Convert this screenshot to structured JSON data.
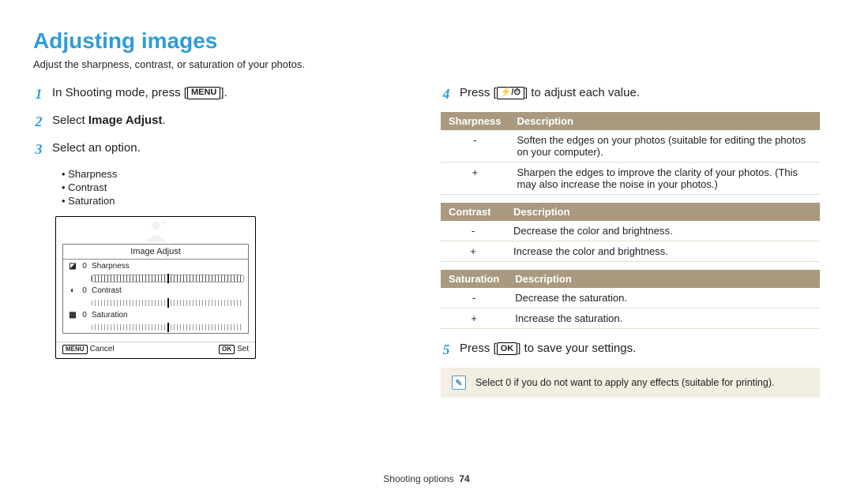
{
  "title": "Adjusting images",
  "intro": "Adjust the sharpness, contrast, or saturation of your photos.",
  "steps": {
    "s1_pre": "In Shooting mode, press [",
    "s1_key": "MENU",
    "s1_post": "].",
    "s2_pre": "Select ",
    "s2_bold": "Image Adjust",
    "s2_post": ".",
    "s3": "Select an option.",
    "s4_pre": "Press [",
    "s4_key": "⚡/⏱",
    "s4_post": "] to adjust each value.",
    "s5_pre": "Press [",
    "s5_key": "OK",
    "s5_post": "] to save your settings."
  },
  "bullets": [
    "Sharpness",
    "Contrast",
    "Saturation"
  ],
  "screenshot": {
    "title": "Image Adjust",
    "rows": [
      {
        "icon": "◪",
        "val": "0",
        "label": "Sharpness",
        "sel": true
      },
      {
        "icon": "◐",
        "val": "0",
        "label": "Contrast",
        "sel": false
      },
      {
        "icon": "▦",
        "val": "0",
        "label": "Saturation",
        "sel": false
      }
    ],
    "cancel_key": "MENU",
    "cancel": "Cancel",
    "set_key": "OK",
    "set": "Set"
  },
  "tables": [
    {
      "h1": "Sharpness",
      "h2": "Description",
      "rows": [
        {
          "k": "-",
          "v": "Soften the edges on your photos (suitable for editing the photos on your computer)."
        },
        {
          "k": "+",
          "v": "Sharpen the edges to improve the clarity of your photos. (This may also increase the noise in your photos.)"
        }
      ]
    },
    {
      "h1": "Contrast",
      "h2": "Description",
      "rows": [
        {
          "k": "-",
          "v": "Decrease the color and brightness."
        },
        {
          "k": "+",
          "v": "Increase the color and brightness."
        }
      ]
    },
    {
      "h1": "Saturation",
      "h2": "Description",
      "rows": [
        {
          "k": "-",
          "v": "Decrease the saturation."
        },
        {
          "k": "+",
          "v": "Increase the saturation."
        }
      ]
    }
  ],
  "note": "Select 0 if you do not want to apply any effects (suitable for printing).",
  "footer_section": "Shooting options",
  "footer_page": "74"
}
